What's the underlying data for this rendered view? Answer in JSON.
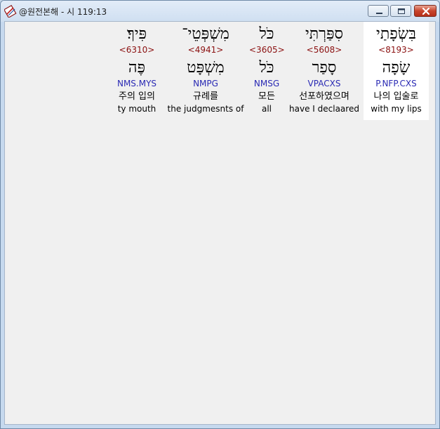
{
  "window": {
    "title": "@원전본해 - 시 119:13"
  },
  "words": [
    {
      "hebrew": "בִּשְׂפָתַי",
      "strong": "<8193>",
      "lemma": "שָׂפָה",
      "morph": "P.NFP.CXS",
      "korean": "나의 입술로",
      "english": "with my lips",
      "selected": true
    },
    {
      "hebrew": "סִפַּרְתִּי",
      "strong": "<5608>",
      "lemma": "סָפַר",
      "morph": "VPACXS",
      "korean": "선포하였으며",
      "english": "have I declaared",
      "selected": false
    },
    {
      "hebrew": "כֹּל",
      "strong": "<3605>",
      "lemma": "כֹּל",
      "morph": "NMSG",
      "korean": "모든",
      "english": "all",
      "selected": false
    },
    {
      "hebrew": "מִשְׁפְּטֵי־",
      "strong": "<4941>",
      "lemma": "מִשְׁפָּט",
      "morph": "NMPG",
      "korean": "규례를",
      "english": "the judgmesnts of",
      "selected": false
    },
    {
      "hebrew": "פִּיךָ׃",
      "strong": "<6310>",
      "lemma": "פֶּה",
      "morph": "NMS.MYS",
      "korean": "주의 입의",
      "english": "ty mouth",
      "selected": false
    }
  ],
  "colors": {
    "strong": "#8b1010",
    "morph": "#2a2ab4",
    "selected_bg": "#ffffff",
    "client_bg": "#f0f0f0"
  },
  "icons": {
    "app": "bible-app-icon",
    "minimize": "minimize-icon",
    "maximize": "maximize-icon",
    "close": "close-icon"
  }
}
